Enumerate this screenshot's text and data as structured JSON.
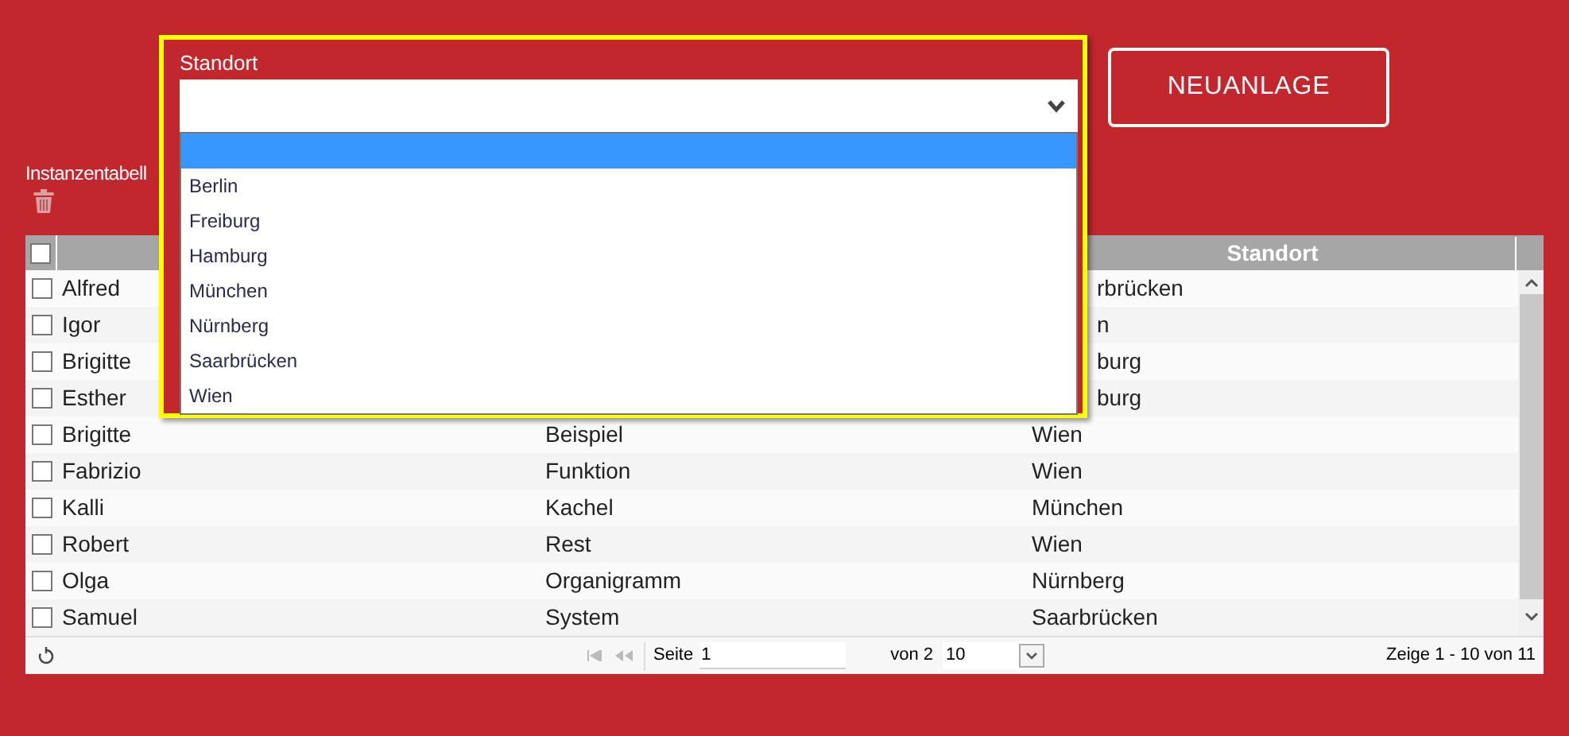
{
  "new_button": {
    "label": "NEUANLAGE"
  },
  "table_title": "Instanzentabell",
  "table": {
    "select_all": {
      "checked": false
    },
    "columns": [
      "Standort"
    ],
    "rows": [
      {
        "checked": false,
        "name": "Alfred",
        "standort": "rbrücken"
      },
      {
        "checked": false,
        "name": "Igor",
        "standort": "n"
      },
      {
        "checked": false,
        "name": "Brigitte",
        "standort": "burg"
      },
      {
        "checked": false,
        "name": "Esther",
        "standort": "burg"
      },
      {
        "checked": false,
        "name": "Brigitte",
        "column_2": "Beispiel",
        "standort": "Wien"
      },
      {
        "checked": false,
        "name": "Fabrizio",
        "column_2": "Funktion",
        "standort": "Wien"
      },
      {
        "checked": false,
        "name": "Kalli",
        "column_2": "Kachel",
        "standort": "München"
      },
      {
        "checked": false,
        "name": "Robert",
        "column_2": "Rest",
        "standort": "Wien"
      },
      {
        "checked": false,
        "name": "Olga",
        "column_2": "Organigramm",
        "standort": "Nürnberg"
      },
      {
        "checked": false,
        "name": "Samuel",
        "column_2": "System",
        "standort": "Saarbrücken"
      }
    ]
  },
  "pager": {
    "page_label": "Seite",
    "page": "1",
    "of_label": "von 2",
    "page_size": "10",
    "summary": "Zeige 1 - 10 von 11"
  },
  "standort_dropdown": {
    "label": "Standort",
    "blank_option": {
      "selected": true
    },
    "options": [
      {
        "label": "Berlin",
        "selected": false
      },
      {
        "label": "Freiburg",
        "selected": false
      },
      {
        "label": "Hamburg",
        "selected": false
      },
      {
        "label": "München",
        "selected": false
      },
      {
        "label": "Nürnberg",
        "selected": false
      },
      {
        "label": "Saarbrücken",
        "selected": false
      },
      {
        "label": "Wien",
        "selected": false
      }
    ]
  }
}
